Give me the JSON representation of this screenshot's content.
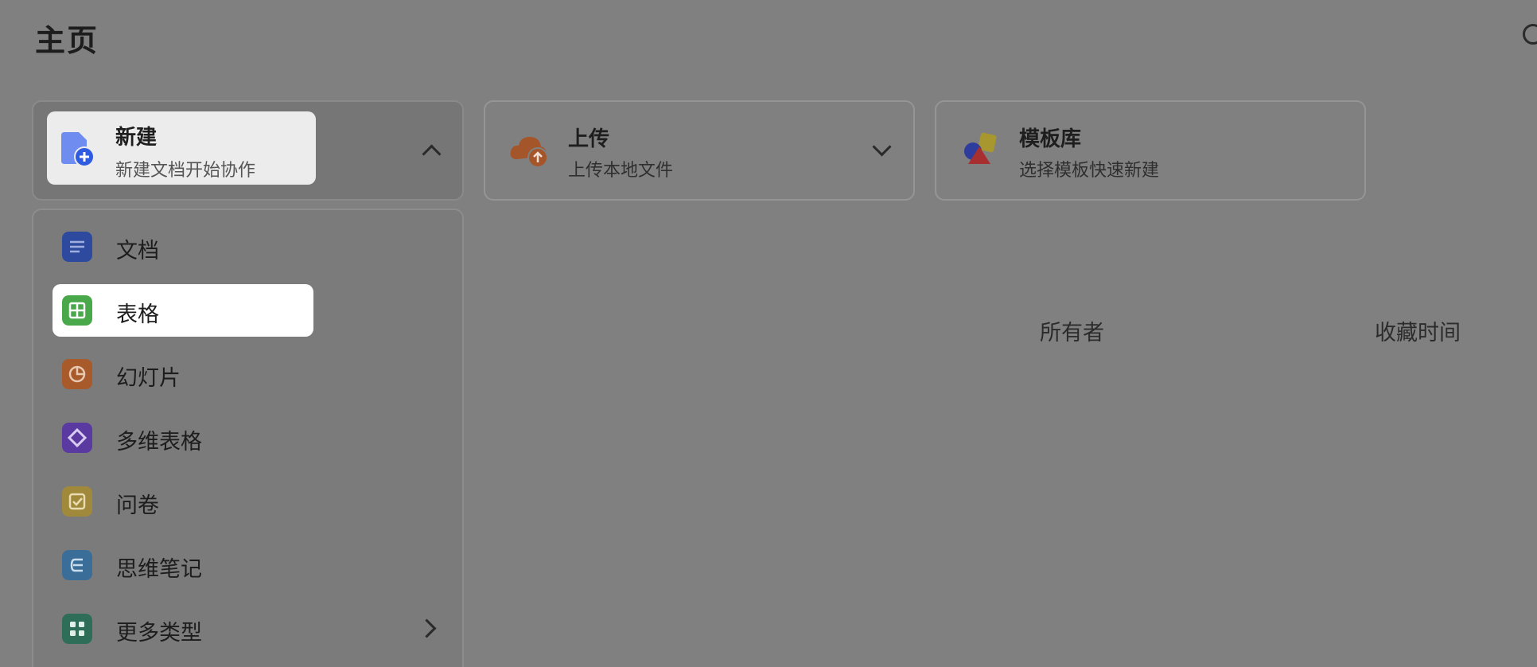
{
  "header": {
    "title": "主页"
  },
  "actions": {
    "new": {
      "title": "新建",
      "subtitle": "新建文档开始协作"
    },
    "upload": {
      "title": "上传",
      "subtitle": "上传本地文件"
    },
    "template": {
      "title": "模板库",
      "subtitle": "选择模板快速新建"
    }
  },
  "menu": {
    "items": [
      {
        "label": "文档",
        "icon": "doc-icon",
        "color": "#2e4a9e"
      },
      {
        "label": "表格",
        "icon": "sheet-icon",
        "color": "#49a84a"
      },
      {
        "label": "幻灯片",
        "icon": "slides-icon",
        "color": "#a85a2a"
      },
      {
        "label": "多维表格",
        "icon": "base-icon",
        "color": "#5a3aa0"
      },
      {
        "label": "问卷",
        "icon": "survey-icon",
        "color": "#a0893a"
      },
      {
        "label": "思维笔记",
        "icon": "mindnote-icon",
        "color": "#3a6e98"
      },
      {
        "label": "更多类型",
        "icon": "grid-icon",
        "color": "#2e6e58"
      }
    ]
  },
  "table": {
    "columns": [
      "所有者",
      "收藏时间"
    ]
  }
}
